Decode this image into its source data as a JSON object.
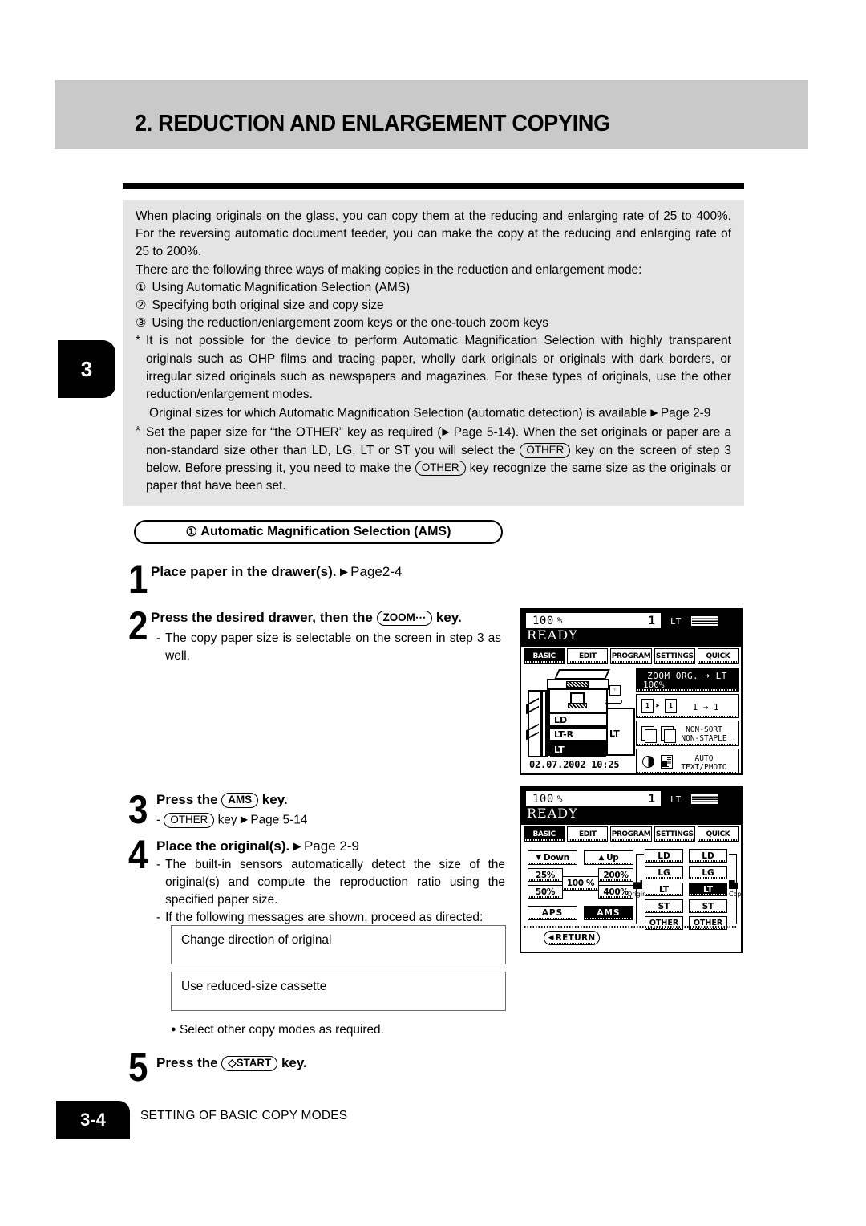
{
  "header": {
    "title": "2. REDUCTION AND ENLARGEMENT COPYING",
    "chapter_tab": "3"
  },
  "intro": {
    "para1": "When placing originals on the glass, you can copy them at the reducing and enlarging rate of 25 to 400%. For the reversing automatic document feeder, you can make the copy at the reducing and enlarging rate of 25 to 200%.",
    "para2": "There are the following three ways of making copies in the reduction and enlargement mode:",
    "list": [
      {
        "marker": "①",
        "text": "Using Automatic Magnification Selection (AMS)"
      },
      {
        "marker": "②",
        "text": "Specifying both original size and copy size"
      },
      {
        "marker": "③",
        "text": "Using the reduction/enlargement zoom keys or the one-touch zoom keys"
      }
    ],
    "note1_marker": "*",
    "note1": "It is not possible for the device to perform Automatic Magnification Selection with highly transparent originals such as OHP films and tracing paper, wholly dark originals or originals with dark borders, or irregular sized originals such as newspapers and magazines. For these types of originals, use the other reduction/enlargement modes.",
    "note1_sub_a": "Original sizes for which Automatic Magnification Selection (automatic detection) is available",
    "note1_sub_a_page": "Page 2-9",
    "note2_marker": "*",
    "note2_a": "Set the paper size for “the OTHER” key as required (",
    "note2_a_page": "Page 5-14",
    "note2_b": "). When the set originals or paper are a non-standard size other than LD, LG, LT or ST you will select the",
    "note2_key1": "OTHER",
    "note2_c": "key on the screen of step 3 below. Before pressing it, you need to make the",
    "note2_key2": "OTHER",
    "note2_d": "key recognize the same size as the originals or paper that have been set."
  },
  "section": {
    "pill_marker": "①",
    "pill_label": "Automatic Magnification Selection (AMS)"
  },
  "steps": [
    {
      "num": "1",
      "title": "Place paper in the drawer(s).",
      "page_ref": "Page2-4"
    },
    {
      "num": "2",
      "title_a": "Press the desired drawer, then the",
      "title_key": "ZOOM⋯",
      "title_b": "key.",
      "bullet_marker": "-",
      "bullet": "The copy paper size is selectable on the screen in step 3 as well."
    },
    {
      "num": "3",
      "title_a": "Press the",
      "title_key": "AMS",
      "title_b": "key.",
      "bullet_marker": "-",
      "bullet_key": "OTHER",
      "bullet_a": "key",
      "bullet_page": "Page 5-14"
    },
    {
      "num": "4",
      "title": "Place the original(s).",
      "page_ref": "Page 2-9",
      "bullet1_marker": "-",
      "bullet1": "The built-in sensors automatically detect the size of the original(s) and compute the reproduction ratio using the specified paper size.",
      "bullet2_marker": "-",
      "bullet2": "If the following messages are shown, proceed as directed:",
      "msgbox1": "Change direction of original",
      "msgbox2": "Use reduced-size cassette",
      "bullet3_marker": "●",
      "bullet3": "Select other copy modes as required."
    },
    {
      "num": "5",
      "title_a": "Press the",
      "title_key": "◇START",
      "title_b": "key."
    }
  ],
  "lcd1": {
    "ratio": "100",
    "percent": "%",
    "count": "1",
    "paper_label": "LT",
    "status": "READY",
    "tabs": [
      {
        "label": "BASIC",
        "selected": true
      },
      {
        "label": "EDIT",
        "selected": false
      },
      {
        "label": "PROGRAM",
        "selected": false
      },
      {
        "label": "SETTINGS",
        "selected": false
      },
      {
        "label": "QUICK",
        "selected": false
      }
    ],
    "copier": {
      "trays": [
        "LD",
        "LT-R",
        "LT"
      ],
      "selected_tray": "LT",
      "bypass_label": "LT",
      "datetime": "02.07.2002 10:25"
    },
    "buttons": [
      {
        "name": "zoom",
        "line1": "ZOOM   ORG. ➜ LT",
        "line2": "100%",
        "selected": true
      },
      {
        "name": "duplex",
        "value": "1 → 1",
        "icon_label": "1"
      },
      {
        "name": "finisher",
        "line1": "NON-SORT",
        "line2": "NON-STAPLE"
      },
      {
        "name": "image-mode",
        "line1": "AUTO",
        "line2": "TEXT/PHOTO"
      }
    ]
  },
  "lcd2": {
    "ratio": "100",
    "percent": "%",
    "count": "1",
    "paper_label": "LT",
    "status": "READY",
    "tabs": [
      {
        "label": "BASIC",
        "selected": true
      },
      {
        "label": "EDIT",
        "selected": false
      },
      {
        "label": "PROGRAM",
        "selected": false
      },
      {
        "label": "SETTINGS",
        "selected": false
      },
      {
        "label": "QUICK",
        "selected": false
      }
    ],
    "down_label": "Down",
    "up_label": "Up",
    "zoom_keys": [
      "25%",
      "200%",
      "50%",
      "400%"
    ],
    "zoom_center": "100 %",
    "aps_label": "APS",
    "ams_label": "AMS",
    "ams_selected": true,
    "original_label": "Original",
    "copy_label": "Copy",
    "original_sizes": [
      "LD",
      "LG",
      "LT",
      "ST",
      "OTHER"
    ],
    "copy_sizes": [
      "LD",
      "LG",
      "LT",
      "ST",
      "OTHER"
    ],
    "copy_selected": "LT",
    "return_label": "RETURN"
  },
  "footer": {
    "page": "3-4",
    "text": "SETTING OF BASIC COPY MODES"
  }
}
